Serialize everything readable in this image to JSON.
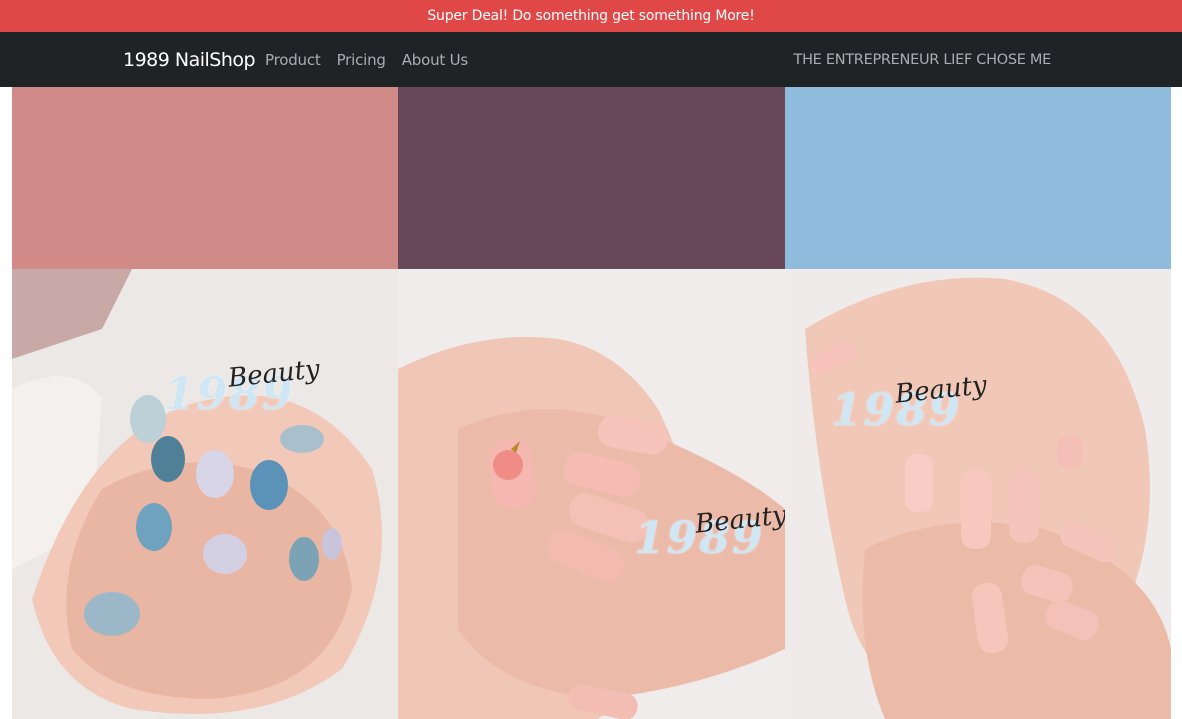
{
  "promo": {
    "text": "Super Deal! Do something get something More!"
  },
  "nav": {
    "brand": "1989 NailShop",
    "links": [
      "Product",
      "Pricing",
      "About Us"
    ],
    "tagline": "THE ENTREPRENEUR LIEF CHOSE ME"
  },
  "colors": {
    "promo_bg": "#e04848",
    "nav_bg": "#1f2326",
    "swatches": [
      "#d08a88",
      "#664858",
      "#8fbcdd"
    ]
  },
  "gallery": {
    "watermark": {
      "number": "1989",
      "word": "Beauty"
    },
    "photos": [
      "nail-art-butterfly-photo",
      "nail-art-peach-photo",
      "nail-art-pink-coffin-photo"
    ]
  }
}
